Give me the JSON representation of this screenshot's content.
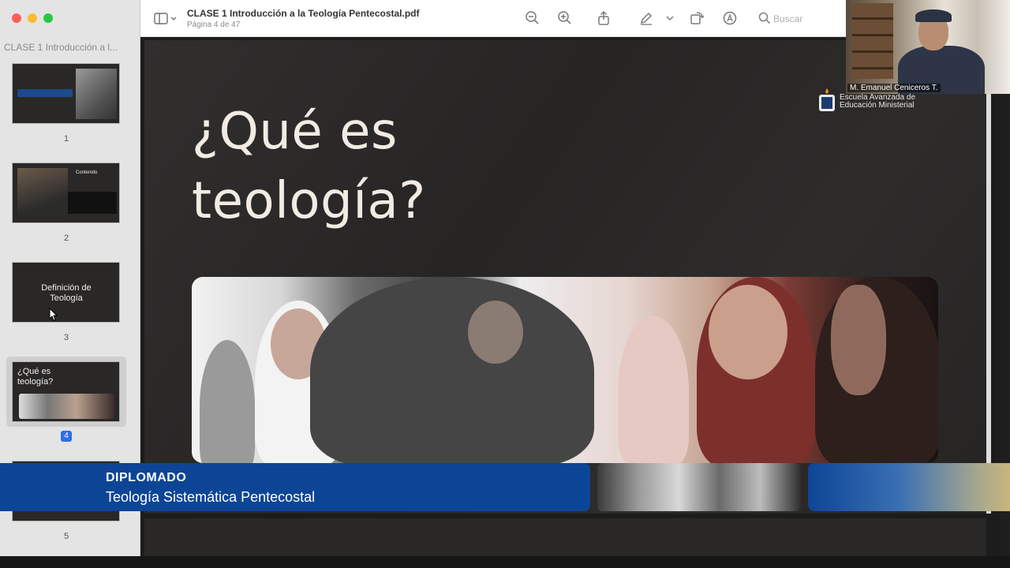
{
  "window": {
    "doc_title": "CLASE 1 Introducción a la Teología Pentecostal.pdf",
    "page_indicator": "Página 4 de 47"
  },
  "sidebar": {
    "title": "CLASE 1 Introducción a l...",
    "thumbnails": [
      {
        "num": "1"
      },
      {
        "num": "2",
        "text": "Contenido"
      },
      {
        "num": "3",
        "text": "Definición de Teología"
      },
      {
        "num": "4",
        "text": "¿Qué es teología?"
      },
      {
        "num": "5"
      }
    ]
  },
  "toolbar": {
    "search_placeholder": "Buscar",
    "icons": [
      "sidebar-toggle-icon",
      "zoom-out-icon",
      "zoom-in-icon",
      "share-icon",
      "markup-pen-icon",
      "chevron-down-icon",
      "rotate-icon",
      "annotate-icon",
      "search-icon"
    ]
  },
  "slide": {
    "heading": "¿Qué es teología?"
  },
  "lower_third": {
    "title": "DIPLOMADO",
    "subtitle": "Teología Sistemática Pentecostal"
  },
  "webcam": {
    "name": "M. Emanuel Ceniceros T."
  },
  "logo": {
    "line1": "Escuela Avanzada de",
    "line2": "Educación Ministerial"
  },
  "colors": {
    "accent_blue": "#0d4596",
    "selected_page_badge": "#2f6ee5",
    "slide_background": "#2a2827"
  }
}
